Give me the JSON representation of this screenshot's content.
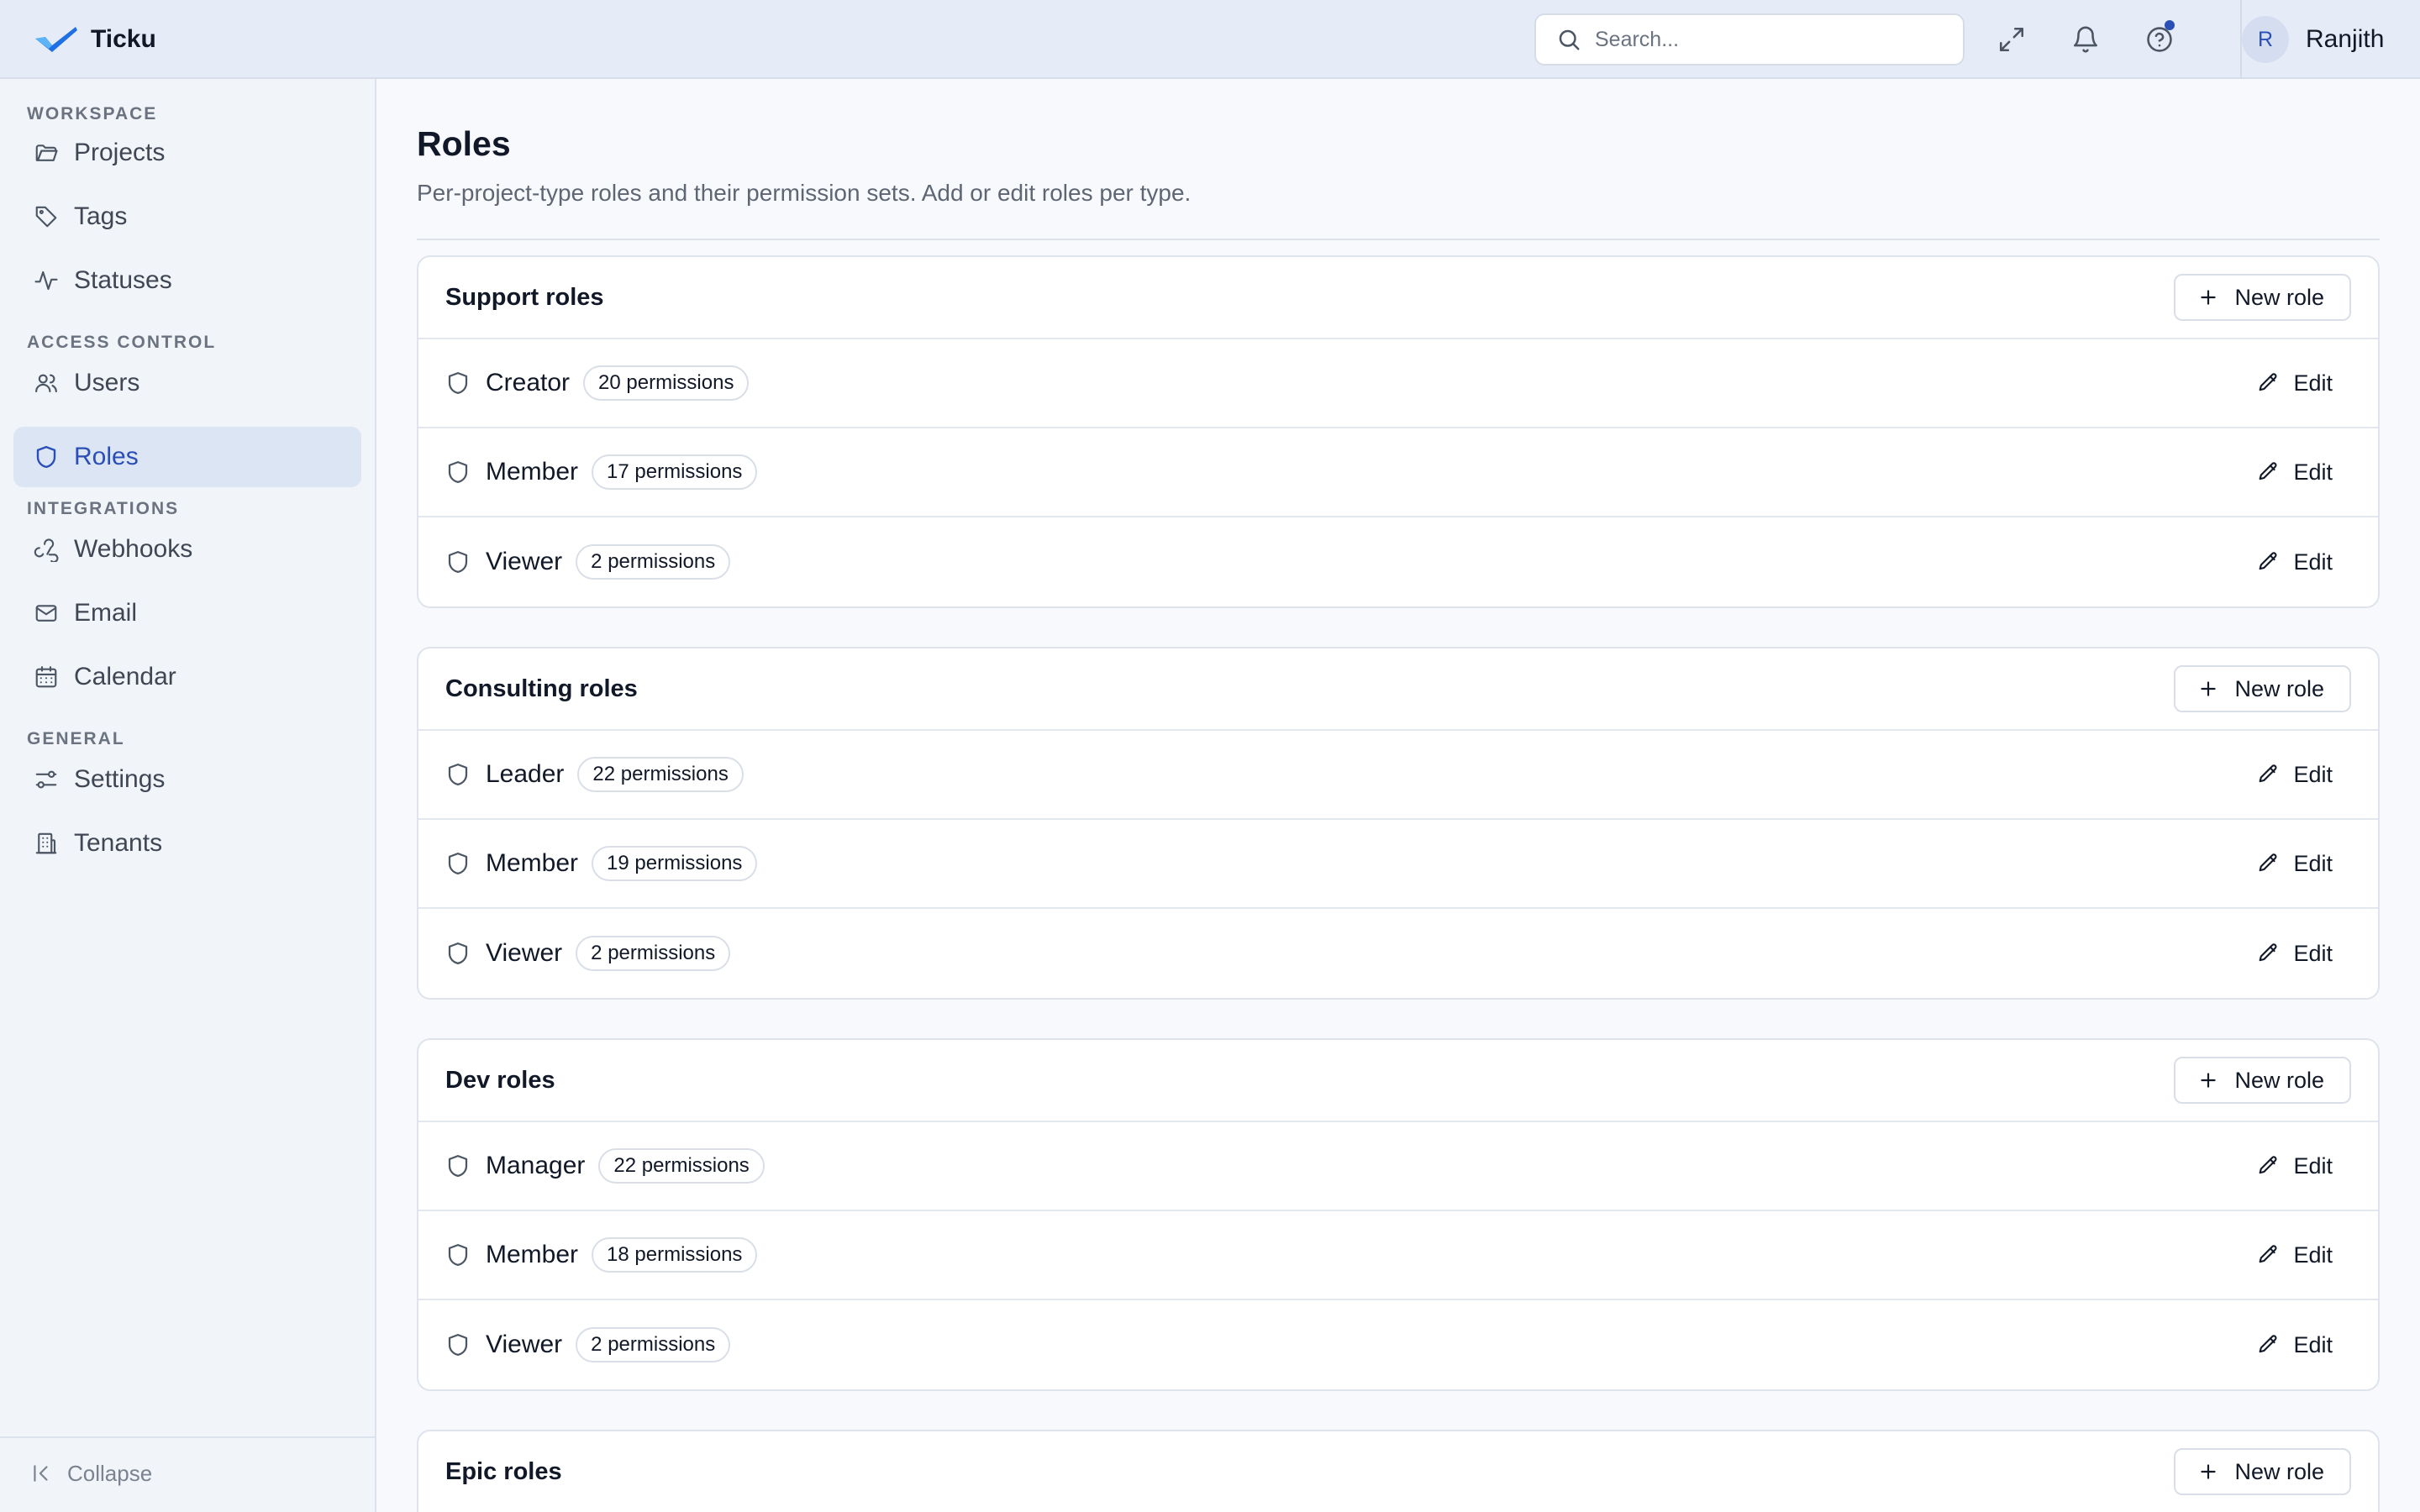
{
  "app": {
    "name": "Ticku"
  },
  "header": {
    "search": {
      "placeholder": "Search...",
      "value": ""
    },
    "icons": [
      "expand-icon",
      "bell-icon",
      "help-icon"
    ],
    "user": {
      "initial": "R",
      "name": "Ranjith"
    }
  },
  "sidebar": {
    "sections": [
      {
        "label": "WORKSPACE",
        "items": [
          {
            "label": "Projects",
            "icon": "folder-icon",
            "active": false
          },
          {
            "label": "Tags",
            "icon": "tag-icon",
            "active": false
          },
          {
            "label": "Statuses",
            "icon": "activity-icon",
            "active": false
          }
        ]
      },
      {
        "label": "ACCESS CONTROL",
        "items": [
          {
            "label": "Users",
            "icon": "users-icon",
            "active": false
          },
          {
            "label": "Roles",
            "icon": "shield-icon",
            "active": true
          }
        ]
      },
      {
        "label": "INTEGRATIONS",
        "items": [
          {
            "label": "Webhooks",
            "icon": "webhook-icon",
            "active": false
          },
          {
            "label": "Email",
            "icon": "mail-icon",
            "active": false
          },
          {
            "label": "Calendar",
            "icon": "calendar-icon",
            "active": false
          }
        ]
      },
      {
        "label": "GENERAL",
        "items": [
          {
            "label": "Settings",
            "icon": "sliders-icon",
            "active": false
          },
          {
            "label": "Tenants",
            "icon": "building-icon",
            "active": false
          }
        ]
      }
    ],
    "collapse_label": "Collapse"
  },
  "page": {
    "title": "Roles",
    "subtitle": "Per-project-type roles and their permission sets. Add or edit roles per type."
  },
  "role_groups": [
    {
      "title": "Support roles",
      "new_label": "New role",
      "roles": [
        {
          "name": "Creator",
          "permissions": "20 permissions",
          "edit_label": "Edit"
        },
        {
          "name": "Member",
          "permissions": "17 permissions",
          "edit_label": "Edit"
        },
        {
          "name": "Viewer",
          "permissions": "2 permissions",
          "edit_label": "Edit"
        }
      ]
    },
    {
      "title": "Consulting roles",
      "new_label": "New role",
      "roles": [
        {
          "name": "Leader",
          "permissions": "22 permissions",
          "edit_label": "Edit"
        },
        {
          "name": "Member",
          "permissions": "19 permissions",
          "edit_label": "Edit"
        },
        {
          "name": "Viewer",
          "permissions": "2 permissions",
          "edit_label": "Edit"
        }
      ]
    },
    {
      "title": "Dev roles",
      "new_label": "New role",
      "roles": [
        {
          "name": "Manager",
          "permissions": "22 permissions",
          "edit_label": "Edit"
        },
        {
          "name": "Member",
          "permissions": "18 permissions",
          "edit_label": "Edit"
        },
        {
          "name": "Viewer",
          "permissions": "2 permissions",
          "edit_label": "Edit"
        }
      ]
    },
    {
      "title": "Epic roles",
      "new_label": "New role",
      "roles": []
    }
  ],
  "colors": {
    "accent": "#2a4fb7",
    "topbar_bg": "#e6ecf7",
    "sidebar_bg": "#f1f4f9",
    "active_item_bg": "#dce5f4"
  }
}
